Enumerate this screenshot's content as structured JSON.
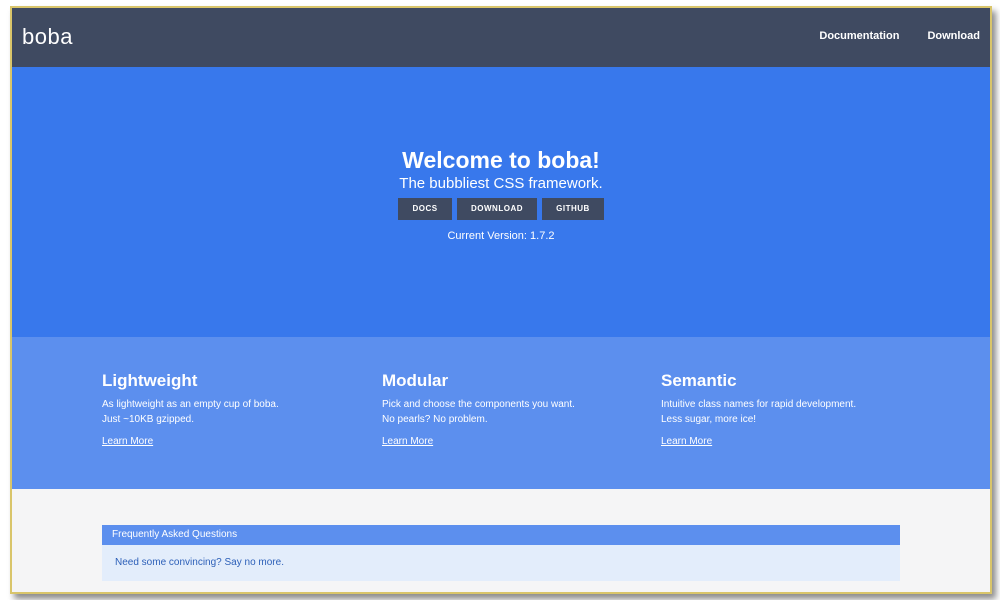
{
  "navbar": {
    "brand": "boba",
    "links": [
      "Documentation",
      "Download"
    ]
  },
  "hero": {
    "title": "Welcome to boba!",
    "subtitle": "The bubbliest CSS framework.",
    "buttons": [
      "DOCS",
      "DOWNLOAD",
      "GITHUB"
    ],
    "version": "Current Version: 1.7.2"
  },
  "features": [
    {
      "title": "Lightweight",
      "line1": "As lightweight as an empty cup of boba.",
      "line2": "Just ~10KB gzipped.",
      "link": "Learn More"
    },
    {
      "title": "Modular",
      "line1": "Pick and choose the components you want.",
      "line2": "No pearls? No problem.",
      "link": "Learn More"
    },
    {
      "title": "Semantic",
      "line1": "Intuitive class names for rapid development.",
      "line2": "Less sugar, more ice!",
      "link": "Learn More"
    }
  ],
  "faq": {
    "header": "Frequently Asked Questions",
    "body": "Need some convincing? Say no more."
  },
  "colors": {
    "navbar": "#3f4a61",
    "hero": "#3878ec",
    "features": "#5c8fee",
    "faq_body": "#e3edfb",
    "page_background": "#f5f5f6"
  }
}
